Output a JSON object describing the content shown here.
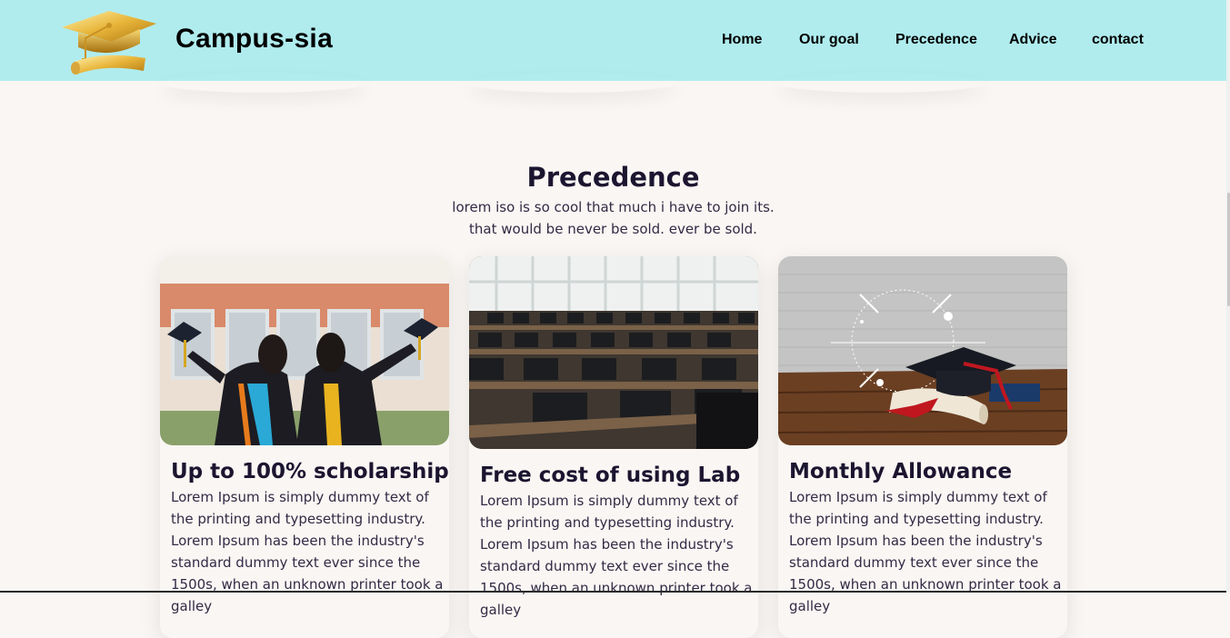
{
  "header": {
    "brand": "Campus-sia",
    "nav": [
      {
        "label": "Home"
      },
      {
        "label": "Our goal"
      },
      {
        "label": "Precedence"
      },
      {
        "label": "Advice"
      },
      {
        "label": "contact"
      }
    ]
  },
  "section": {
    "title": "Precedence",
    "subtitle_line1": "lorem iso is so cool that much i have to join its.",
    "subtitle_line2": "that would be never be sold. ever be sold."
  },
  "cards": [
    {
      "title": "Up to 100% scholarship",
      "text": "Lorem Ipsum is simply dummy text of the printing and typesetting industry. Lorem Ipsum has been the industry's standard dummy text ever since the 1500s, when an unknown printer took a galley"
    },
    {
      "title": "Free cost of using Lab",
      "text": "Lorem Ipsum is simply dummy text of the printing and typesetting industry. Lorem Ipsum has been the industry's standard dummy text ever since the 1500s, when an unknown printer took a galley"
    },
    {
      "title": "Monthly Allowance",
      "text": "Lorem Ipsum is simply dummy text of the printing and typesetting industry. Lorem Ipsum has been the industry's standard dummy text ever since the 1500s, when an unknown printer took a galley"
    }
  ],
  "colors": {
    "navbar": "#b0ecee",
    "page_bg": "#f9f6f3",
    "heading": "#1c1530"
  },
  "icons": {
    "logo": "graduation-cap-logo"
  }
}
